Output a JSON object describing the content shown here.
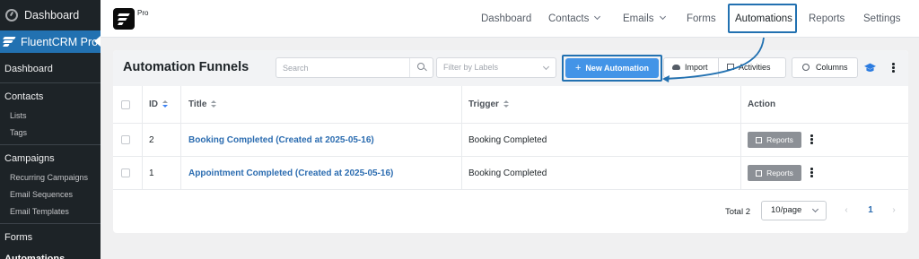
{
  "sidebar": {
    "dashboard_top": "Dashboard",
    "active_plugin": "FluentCRM Pro",
    "items": [
      {
        "label": "Dashboard",
        "type": "head"
      },
      {
        "type": "sep"
      },
      {
        "label": "Contacts",
        "type": "head"
      },
      {
        "label": "Lists",
        "type": "child"
      },
      {
        "label": "Tags",
        "type": "child"
      },
      {
        "type": "sep"
      },
      {
        "label": "Campaigns",
        "type": "head"
      },
      {
        "label": "Recurring Campaigns",
        "type": "child"
      },
      {
        "label": "Email Sequences",
        "type": "child"
      },
      {
        "label": "Email Templates",
        "type": "child"
      },
      {
        "type": "sep"
      },
      {
        "label": "Forms",
        "type": "head"
      },
      {
        "label": "Automations",
        "type": "head",
        "current": true
      }
    ]
  },
  "topbar": {
    "brand_badge": "Pro",
    "nav": {
      "dashboard": "Dashboard",
      "contacts": "Contacts",
      "emails": "Emails",
      "forms": "Forms",
      "automations": "Automations",
      "reports": "Reports",
      "settings": "Settings"
    }
  },
  "panel": {
    "title": "Automation Funnels",
    "search_placeholder": "Search",
    "filter_placeholder": "Filter by Labels",
    "new_button": "New Automation",
    "import_button": "Import",
    "activities_button": "Activities",
    "columns_button": "Columns"
  },
  "table": {
    "headers": {
      "id": "ID",
      "title": "Title",
      "trigger": "Trigger",
      "action": "Action"
    },
    "rows": [
      {
        "id": "2",
        "title": "Booking Completed (Created at 2025-05-16)",
        "trigger": "Booking Completed",
        "action": "Reports"
      },
      {
        "id": "1",
        "title": "Appointment Completed (Created at 2025-05-16)",
        "trigger": "Booking Completed",
        "action": "Reports"
      }
    ]
  },
  "pagination": {
    "total_label": "Total 2",
    "per_page": "10/page",
    "prev": "‹",
    "current_page": "1",
    "next": "›"
  },
  "colors": {
    "sidebar_bg": "#1d2327",
    "active_blue": "#2271b1",
    "primary_button": "#4394e7",
    "link": "#2b6cb0",
    "highlight": "#2271b1"
  }
}
